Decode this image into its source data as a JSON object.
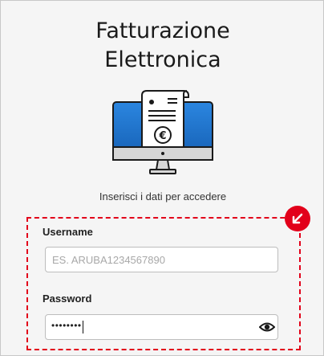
{
  "header": {
    "title_line1": "Fatturazione",
    "title_line2": "Elettronica"
  },
  "illustration": {
    "icon": "monitor-invoice-euro-icon",
    "currency_symbol": "€"
  },
  "subtitle": "Inserisci i dati per accedere",
  "login": {
    "username": {
      "label": "Username",
      "value": "",
      "placeholder": "ES. ARUBA1234567890"
    },
    "password": {
      "label": "Password",
      "value_masked": "••••••••"
    },
    "badge_icon": "arrow-down-left-icon",
    "toggle_visibility_icon": "eye-icon"
  },
  "colors": {
    "accent": "#e2001a",
    "screen_blue": "#1e6fc9",
    "background": "#f5f5f5"
  }
}
